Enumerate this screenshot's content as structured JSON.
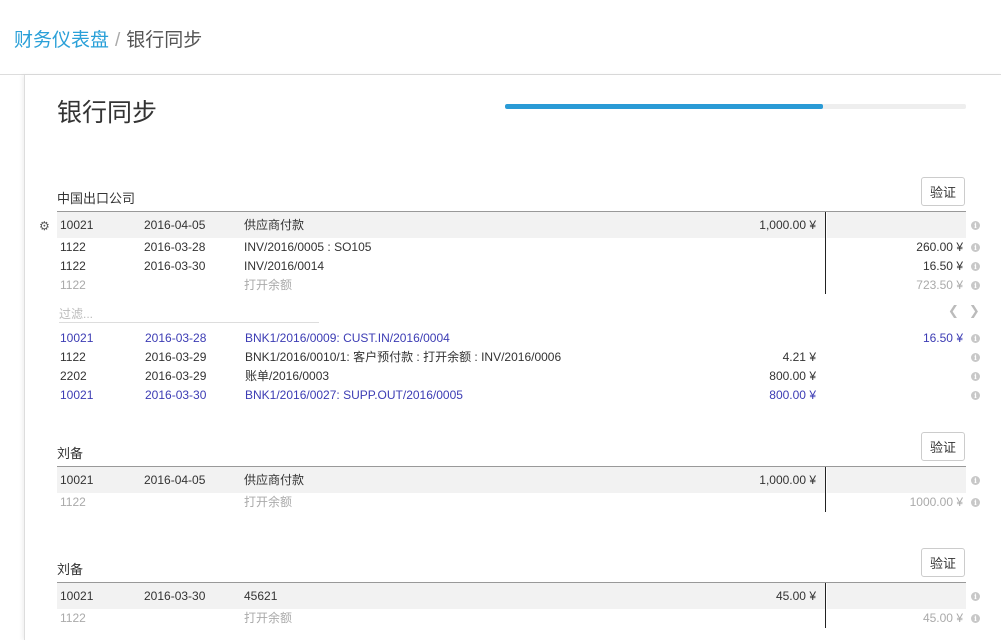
{
  "breadcrumb": {
    "parent": "财务仪表盘",
    "separator": "/",
    "current": "银行同步"
  },
  "page_title": "银行同步",
  "progress": {
    "fraction": 0.69
  },
  "verify_label": "验证",
  "icons": {
    "gear": "gear-icon",
    "info": "info-icon",
    "prev": "chevron-left-icon",
    "next": "chevron-right-icon"
  },
  "colors": {
    "link": "#2aa0d8",
    "proposition": "#3c3cb4",
    "muted": "#aaaaaa"
  },
  "reconciliations": [
    {
      "partner": "中国出口公司",
      "statement_line": {
        "account": "10021",
        "date": "2016-04-05",
        "label": "供应商付款",
        "debit": "1,000.00 ¥"
      },
      "matched": [
        {
          "account": "1122",
          "date": "2016-03-28",
          "label": "INV/2016/0005 : SO105",
          "credit": "260.00 ¥"
        },
        {
          "account": "1122",
          "date": "2016-03-30",
          "label": "INV/2016/0014",
          "credit": "16.50 ¥"
        }
      ],
      "open_balance": {
        "account": "1122",
        "label": "打开余额",
        "credit": "723.50 ¥"
      },
      "filter_placeholder": "过滤...",
      "propositions": [
        {
          "account": "10021",
          "date": "2016-03-28",
          "label": "BNK1/2016/0009: CUST.IN/2016/0004",
          "debit": "",
          "credit": "16.50 ¥",
          "highlight": true
        },
        {
          "account": "1122",
          "date": "2016-03-29",
          "label": "BNK1/2016/0010/1: 客户预付款 : 打开余额 : INV/2016/0006",
          "debit": "4.21 ¥",
          "credit": "",
          "highlight": false
        },
        {
          "account": "2202",
          "date": "2016-03-29",
          "label": "账单/2016/0003",
          "debit": "800.00 ¥",
          "credit": "",
          "highlight": false
        },
        {
          "account": "10021",
          "date": "2016-03-30",
          "label": "BNK1/2016/0027: SUPP.OUT/2016/0005",
          "debit": "800.00 ¥",
          "credit": "",
          "highlight": true
        }
      ]
    },
    {
      "partner": "刘备",
      "statement_line": {
        "account": "10021",
        "date": "2016-04-05",
        "label": "供应商付款",
        "debit": "1,000.00 ¥"
      },
      "open_balance": {
        "account": "1122",
        "label": "打开余额",
        "credit": "1000.00 ¥"
      }
    },
    {
      "partner": "刘备",
      "statement_line": {
        "account": "10021",
        "date": "2016-03-30",
        "label": "45621",
        "debit": "45.00 ¥"
      },
      "open_balance": {
        "account": "1122",
        "label": "打开余额",
        "credit": "45.00 ¥"
      }
    }
  ]
}
